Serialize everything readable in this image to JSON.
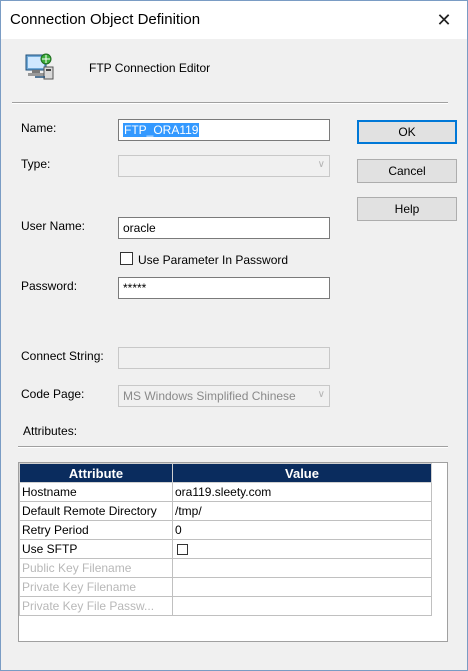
{
  "window": {
    "title": "Connection Object Definition",
    "close_glyph": "✕"
  },
  "header": {
    "icon": "ftp-connection-icon",
    "text": "FTP Connection Editor"
  },
  "form": {
    "name_label": "Name:",
    "name_value": "FTP_ORA119",
    "type_label": "Type:",
    "type_value": "",
    "user_label": "User Name:",
    "user_value": "oracle",
    "use_param_label": "Use Parameter In Password",
    "use_param_checked": false,
    "password_label": "Password:",
    "password_value": "*****",
    "connect_label": "Connect String:",
    "connect_value": "",
    "codepage_label": "Code Page:",
    "codepage_value": "MS Windows Simplified Chinese",
    "attributes_label": "Attributes:"
  },
  "buttons": {
    "ok": "OK",
    "cancel": "Cancel",
    "help": "Help"
  },
  "attributes_table": {
    "headers": [
      "Attribute",
      "Value"
    ],
    "rows": [
      {
        "attribute": "Hostname",
        "value": "ora119.sleety.com",
        "enabled": true
      },
      {
        "attribute": "Default Remote Directory",
        "value": "/tmp/",
        "enabled": true
      },
      {
        "attribute": "Retry Period",
        "value": "0",
        "enabled": true
      },
      {
        "attribute": "Use SFTP",
        "value": "",
        "enabled": true
      },
      {
        "attribute": "Public Key Filename",
        "value": "",
        "enabled": false
      },
      {
        "attribute": "Private Key Filename",
        "value": "",
        "enabled": false
      },
      {
        "attribute": "Private Key File Passw...",
        "value": "",
        "enabled": false
      }
    ]
  },
  "colors": {
    "header_bg": "#0a2c5e",
    "selection": "#3399ff",
    "default_button_border": "#0078d7"
  }
}
